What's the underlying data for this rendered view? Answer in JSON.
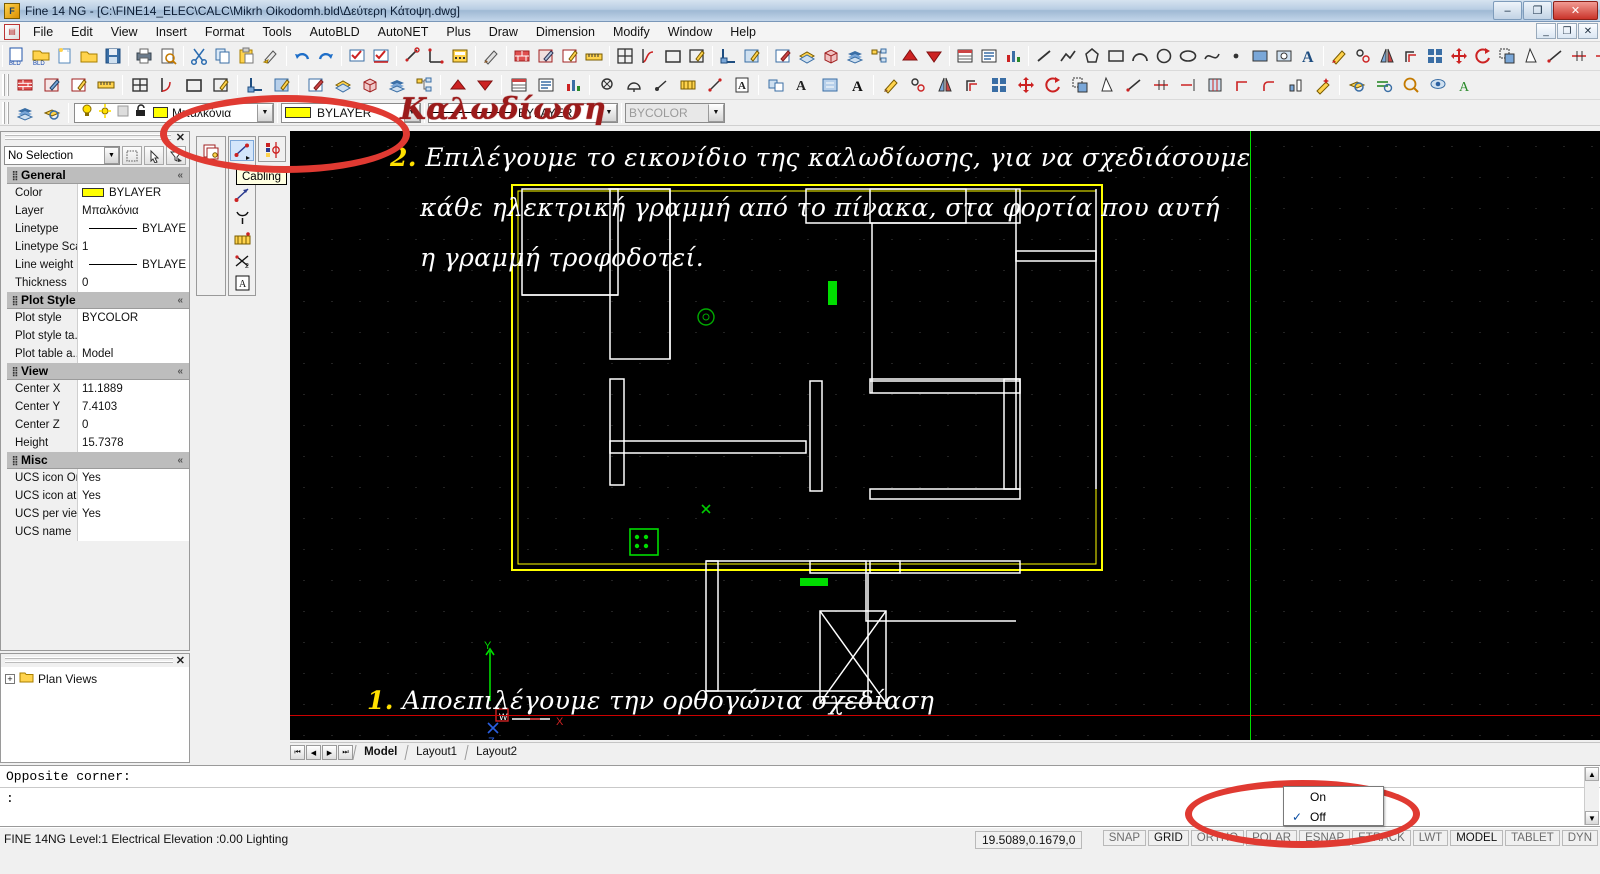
{
  "window": {
    "title": "Fine 14 NG  - [C:\\FINE14_ELEC\\CALC\\Mikrh Oikodomh.bld\\Δεύτερη Κάτοψη.dwg]",
    "minimize": "–",
    "maximize": "❐",
    "close": "✕",
    "mdi_minimize": "_",
    "mdi_restore": "❐",
    "mdi_close": "✕"
  },
  "menu": {
    "items": [
      "File",
      "Edit",
      "View",
      "Insert",
      "Format",
      "Tools",
      "AutoBLD",
      "AutoNET",
      "Plus",
      "Draw",
      "Dimension",
      "Modify",
      "Window",
      "Help"
    ]
  },
  "propbar": {
    "layer_name": "Μπαλκόνια",
    "color_value": "BYLAYER",
    "linetype_value": "BYLAYER",
    "plotstyle_value": "BYCOLOR",
    "arrow": "▼"
  },
  "properties_palette": {
    "close": "✕",
    "selection": "No Selection",
    "groups": [
      {
        "name": "General",
        "chevron": "«",
        "rows": [
          {
            "key": "Color",
            "value": "BYLAYER",
            "style": "swatch"
          },
          {
            "key": "Layer",
            "value": "Μπαλκόνια",
            "style": "text"
          },
          {
            "key": "Linetype",
            "value": "BYLAYE",
            "style": "line"
          },
          {
            "key": "Linetype Scale",
            "value": "1",
            "style": "text"
          },
          {
            "key": "Line weight",
            "value": "BYLAYE",
            "style": "line"
          },
          {
            "key": "Thickness",
            "value": "0",
            "style": "text"
          }
        ]
      },
      {
        "name": "Plot Style",
        "chevron": "«",
        "rows": [
          {
            "key": "Plot style",
            "value": "BYCOLOR",
            "style": "text"
          },
          {
            "key": "Plot style ta...",
            "value": "",
            "style": "text"
          },
          {
            "key": "Plot table a...",
            "value": "Model",
            "style": "text"
          }
        ]
      },
      {
        "name": "View",
        "chevron": "«",
        "rows": [
          {
            "key": "Center X",
            "value": "11.1889",
            "style": "text"
          },
          {
            "key": "Center Y",
            "value": "7.4103",
            "style": "text"
          },
          {
            "key": "Center Z",
            "value": "0",
            "style": "text"
          },
          {
            "key": "Height",
            "value": "15.7378",
            "style": "text"
          }
        ]
      },
      {
        "name": "Misc",
        "chevron": "«",
        "rows": [
          {
            "key": "UCS icon On",
            "value": "Yes",
            "style": "text"
          },
          {
            "key": "UCS icon at...",
            "value": "Yes",
            "style": "text"
          },
          {
            "key": "UCS per vie...",
            "value": "Yes",
            "style": "text"
          },
          {
            "key": "UCS name",
            "value": "",
            "style": "text"
          }
        ]
      }
    ]
  },
  "plan_views": {
    "title": "Plan Views",
    "close": "✕",
    "expand": "+"
  },
  "floating_toolbar": {
    "tooltip": "Cabling"
  },
  "annotations": {
    "title": "Καλωδίωση",
    "step2_number": "2.",
    "step2_lines": [
      "Επιλέγουμε το εικονίδιο της καλωδίωσης, για να σχεδιάσουμε",
      "κάθε ηλεκτρική γραμμή από το πίνακα, στα φορτία που αυτή",
      "η γραμμή τροφοδοτεί."
    ],
    "step1_number": "1.",
    "step1_text": "Αποεπιλέγουμε την ορθογώνια σχεδίαση"
  },
  "layout_tabs": {
    "nav": [
      "⏮",
      "◀",
      "▶",
      "⏭"
    ],
    "tabs": [
      "Model",
      "Layout1",
      "Layout2"
    ],
    "active": "Model"
  },
  "command_line": {
    "history": "Opposite corner:",
    "prompt": ":",
    "scroll_up": "▲",
    "scroll_down": "▼"
  },
  "status_bar": {
    "left_text": "FINE 14NG Level:1  Electrical Elevation :0.00 Lighting",
    "coordinates": "19.5089,0.1679,0",
    "toggles": [
      {
        "label": "SNAP",
        "on": false
      },
      {
        "label": "GRID",
        "on": true
      },
      {
        "label": "ORTHO",
        "on": false
      },
      {
        "label": "POLAR",
        "on": false
      },
      {
        "label": "ESNAP",
        "on": false
      },
      {
        "label": "ETRACK",
        "on": false
      },
      {
        "label": "LWT",
        "on": false
      },
      {
        "label": "MODEL",
        "on": true
      },
      {
        "label": "TABLET",
        "on": false
      },
      {
        "label": "DYN",
        "on": false
      }
    ]
  },
  "ortho_popup": {
    "items": [
      {
        "label": "On",
        "checked": false
      },
      {
        "label": "Off",
        "checked": true
      }
    ],
    "check_glyph": "✓"
  },
  "colors": {
    "canvas_bg": "#000000",
    "accent_red": "#e03a32",
    "annotation_red": "#9b1b1b",
    "highlight_yellow": "#ffe000",
    "crosshair_green": "#00dd00",
    "layer_yellow": "#ffff00"
  }
}
